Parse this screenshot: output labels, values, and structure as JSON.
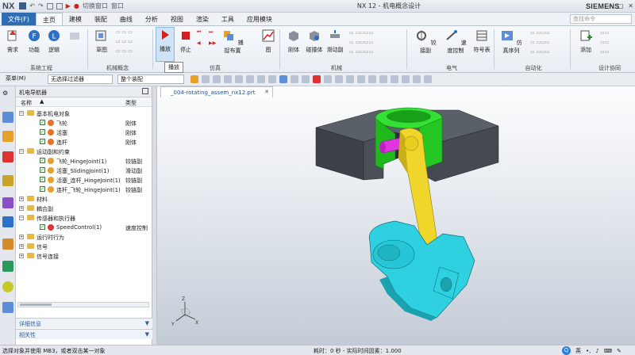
{
  "titlebar": {
    "logo": "NX",
    "switch_window": "切换窗口",
    "window_menu": "窗口",
    "title": "NX 12 - 机电概念设计",
    "brand": "SIEMENS",
    "minimize": "—",
    "maximize": "□",
    "close": "✕"
  },
  "menu": {
    "file": "文件(F)",
    "tabs": [
      "主页",
      "建模",
      "装配",
      "曲线",
      "分析",
      "视图",
      "渲染",
      "工具",
      "应用模块"
    ],
    "active_tab": "主页",
    "search_placeholder": "查找命令"
  },
  "ribbon": {
    "buttons": {
      "requirements": "需求",
      "function": "功能",
      "logic": "逻辑",
      "sketch": "草图",
      "play": "播放",
      "stop": "停止",
      "capture_layout": "捕捉布置",
      "chart": "图",
      "rigid_body": "刚体",
      "collision_body": "碰撞体",
      "conveyor": "滑动副",
      "hinge_joint": "铰接副",
      "speed_control": "速度控制",
      "signal_adapter": "符号表",
      "sim_sequence": "仿真序列",
      "add": "添加"
    },
    "groups": {
      "system_engineering": "系统工程",
      "mechanical_concept": "机械概念",
      "simulation": "仿真",
      "mechanical": "机械",
      "electrical": "电气",
      "automation": "自动化",
      "design_collaboration": "设计协同"
    },
    "tooltip": "播放"
  },
  "toolbar": {
    "menu_label": "菜单(M)",
    "filter": "无选择过滤器",
    "scope": "整个装配"
  },
  "navigator": {
    "title": "机电导航器",
    "col_name": "名称",
    "col_type": "类型",
    "rows": [
      {
        "label": "基本机电对象",
        "type": "",
        "indent": 0,
        "kind": "folder",
        "expanded": true
      },
      {
        "label": "飞轮",
        "type": "刚体",
        "indent": 2,
        "kind": "rigid"
      },
      {
        "label": "活塞",
        "type": "刚体",
        "indent": 2,
        "kind": "rigid"
      },
      {
        "label": "连杆",
        "type": "刚体",
        "indent": 2,
        "kind": "rigid"
      },
      {
        "label": "运动副和约束",
        "type": "",
        "indent": 0,
        "kind": "folder",
        "expanded": true
      },
      {
        "label": "飞轮_HingeJoint(1)",
        "type": "铰链副",
        "indent": 2,
        "kind": "joint"
      },
      {
        "label": "活塞_SlidingJoint(1)",
        "type": "滑动副",
        "indent": 2,
        "kind": "joint"
      },
      {
        "label": "活塞_连杆_HingeJoint(1)",
        "type": "铰链副",
        "indent": 2,
        "kind": "joint"
      },
      {
        "label": "连杆_飞轮_HingeJoint(1)",
        "type": "铰链副",
        "indent": 2,
        "kind": "joint"
      },
      {
        "label": "材料",
        "type": "",
        "indent": 0,
        "kind": "folder"
      },
      {
        "label": "耦合副",
        "type": "",
        "indent": 0,
        "kind": "folder"
      },
      {
        "label": "传感器和执行器",
        "type": "",
        "indent": 0,
        "kind": "folder",
        "expanded": true
      },
      {
        "label": "SpeedControl(1)",
        "type": "速度控制",
        "indent": 2,
        "kind": "speed"
      },
      {
        "label": "运行时行为",
        "type": "",
        "indent": 0,
        "kind": "folder"
      },
      {
        "label": "信号",
        "type": "",
        "indent": 0,
        "kind": "folder"
      },
      {
        "label": "信号连接",
        "type": "",
        "indent": 0,
        "kind": "folder"
      }
    ],
    "panels": [
      "详细信息",
      "相关性"
    ]
  },
  "viewport": {
    "doc_tab": "_004-rotating_assem_nx12.prt",
    "colors": {
      "block": "#454a52",
      "piston": "#2fd02f",
      "pin": "#d01fd0",
      "rod": "#e8d020",
      "flywheel": "#26c6d6"
    }
  },
  "status": {
    "prompt": "选择对象并使用 MB3，或者双击某一对象",
    "sim_time": "耗时：0 秒 - 实际时间因素：1.000",
    "tray_lang": "英"
  }
}
